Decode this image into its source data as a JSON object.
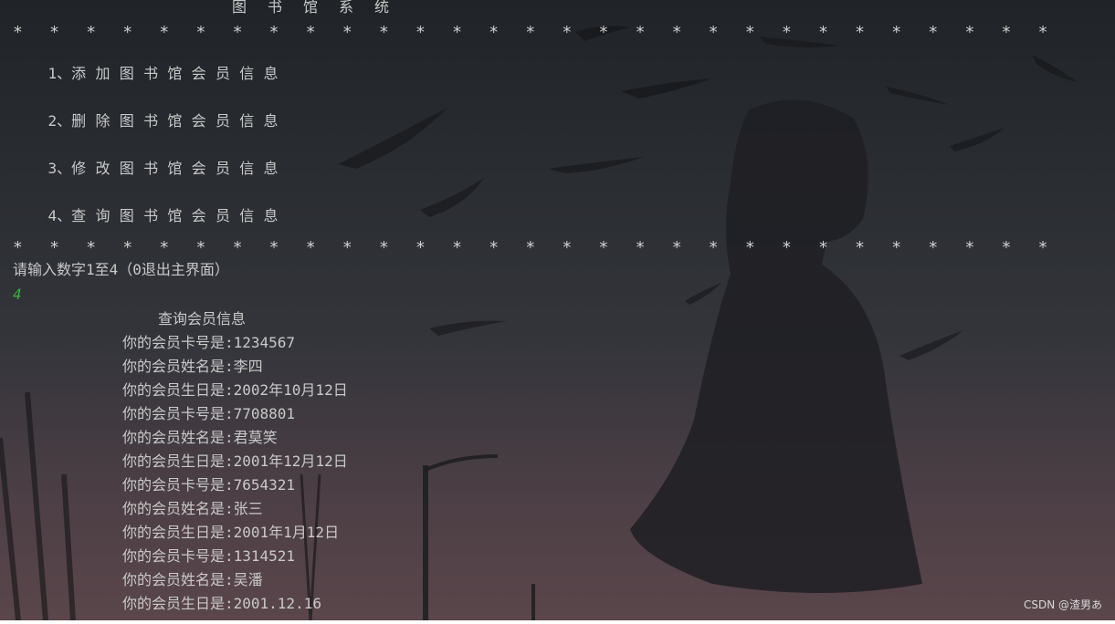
{
  "title_chars": [
    "图",
    "书",
    "馆",
    "系",
    "统"
  ],
  "stars_count": 29,
  "menu": [
    {
      "num": "1、",
      "text": "添加图书馆会员信息"
    },
    {
      "num": "2、",
      "text": "删除图书馆会员信息"
    },
    {
      "num": "3、",
      "text": "修改图书馆会员信息"
    },
    {
      "num": "4、",
      "text": "查询图书馆会员信息"
    }
  ],
  "prompt": "请输入数字1至4（0退出主界面）",
  "user_input": "4",
  "query_title": "查询会员信息",
  "records": [
    "你的会员卡号是:1234567",
    "你的会员姓名是:李四",
    "你的会员生日是:2002年10月12日",
    "你的会员卡号是:7708801",
    "你的会员姓名是:君莫笑",
    "你的会员生日是:2001年12月12日",
    "你的会员卡号是:7654321",
    "你的会员姓名是:张三",
    "你的会员生日是:2001年1月12日",
    "你的会员卡号是:1314521",
    "你的会员姓名是:吴潘",
    "你的会员生日是:2001.12.16"
  ],
  "watermark": "CSDN @渣男あ"
}
